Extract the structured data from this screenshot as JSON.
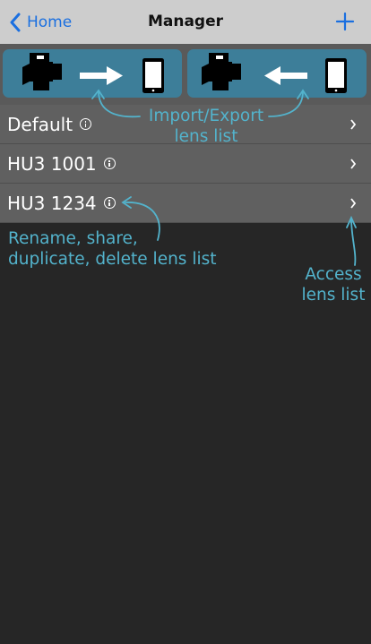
{
  "navbar": {
    "back_label": "Home",
    "title": "Manager",
    "back_icon": "chevron-left-icon",
    "add_icon": "plus-icon"
  },
  "transfer": {
    "import": {
      "icon": "camera-to-phone-icon"
    },
    "export": {
      "icon": "phone-to-camera-icon"
    }
  },
  "lens_lists": [
    {
      "name": "Default"
    },
    {
      "name": "HU3 1001"
    },
    {
      "name": "HU3 1234"
    }
  ],
  "annotations": {
    "import_export": [
      "Import/Export",
      "lens list"
    ],
    "rename": [
      "Rename, share,",
      "duplicate, delete lens list"
    ],
    "access": [
      "Access",
      "lens list"
    ]
  },
  "colors": {
    "accent": "#1a6fe0",
    "annotation": "#53b3cc",
    "panel": "#3d7e99"
  }
}
